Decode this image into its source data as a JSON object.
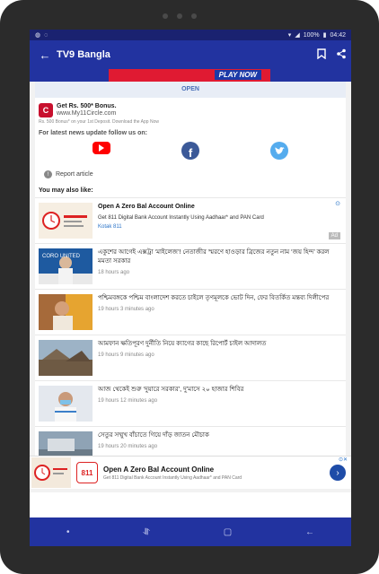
{
  "status": {
    "time": "04:42",
    "battery": "100%"
  },
  "app": {
    "title": "TV9 Bangla"
  },
  "ad_top": {
    "play_label": "PLAY NOW",
    "open_label": "OPEN"
  },
  "mycircle": {
    "logo": "C",
    "headline": "Get Rs. 500* Bonus.",
    "site": "www.My11Circle.com",
    "small": "Rs. 500 Bonus* on your 1st Deposit. Download the App Now"
  },
  "follow_text": "For latest news update follow us on:",
  "report_label": "Report article",
  "may_like_label": "You may also like:",
  "ad_item": {
    "title": "Open A Zero Bal Account Online",
    "subtitle": "Get 811 Digital Bank Account Instantly Using Aadhaar* and PAN Card",
    "brand": "Kotak 811",
    "badge": "Ad"
  },
  "news": [
    {
      "title": "একুশের আগেই এক্সট্রা ‘মাইলেজ’! নেতাজীর স্মরণে হাওড়ার ব্রিজের নতুন নাম ‘জয় হিন্দ’ করল মমতা সরকার",
      "meta": "18 hours ago"
    },
    {
      "title": "পশ্চিমবঙ্গকে পশ্চিম বাংলাদেশ করতে চাইলে তৃণমূলকে ভোট দিন, ফের বিতর্কিত মন্তব্য দিলীপের",
      "meta": "19 hours 3 minutes ago"
    },
    {
      "title": "আমফান ক্ষতিপূরণ দুর্নীতি নিয়ে ক্যাগের কাছে রিপোর্ট চাইল আদালত",
      "meta": "19 hours 9 minutes ago"
    },
    {
      "title": "আজ থেকেই শুরু ‘দুয়ারে সরকার’, দু’মাসে ২০ হাজার শিবির",
      "meta": "19 hours 12 minutes ago"
    },
    {
      "title": "সেতুর সম্মুখ বাঁচাতে গিয়ে দাঁড় জাতন মৌচাক",
      "meta": "19 hours 20 minutes ago"
    }
  ],
  "bottom_ad": {
    "logo": "811",
    "title": "Open A Zero Bal Account Online",
    "subtitle": "Get 811 Digital Bank Account Instantly Using Aadhaar* and PAN Card"
  },
  "colors": {
    "primary": "#2233a0",
    "accent": "#e01a32"
  }
}
